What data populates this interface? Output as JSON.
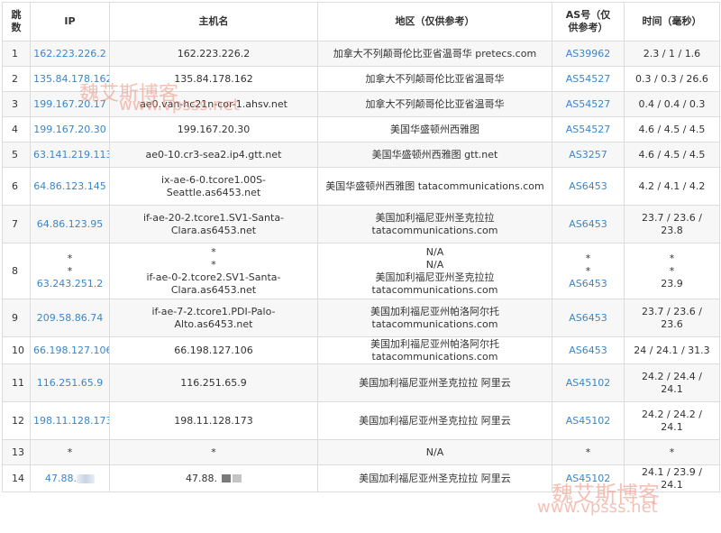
{
  "headers": {
    "hop": "跳数",
    "ip": "IP",
    "host": "主机名",
    "region": "地区（仅供参考）",
    "as": "AS号（仅供参考）",
    "time": "时间（毫秒）"
  },
  "rows": [
    {
      "hop": "1",
      "ip": [
        "162.223.226.2"
      ],
      "host": [
        "162.223.226.2"
      ],
      "region": [
        "加拿大不列颠哥伦比亚省温哥华 pretecs.com"
      ],
      "as": [
        "AS39962"
      ],
      "time": [
        "2.3 / 1 / 1.6"
      ]
    },
    {
      "hop": "2",
      "ip": [
        "135.84.178.162"
      ],
      "host": [
        "135.84.178.162"
      ],
      "region": [
        "加拿大不列颠哥伦比亚省温哥华"
      ],
      "as": [
        "AS54527"
      ],
      "time": [
        "0.3 / 0.3 / 26.6"
      ]
    },
    {
      "hop": "3",
      "ip": [
        "199.167.20.17"
      ],
      "host": [
        "ae0.van-hc21n-cor-1.ahsv.net"
      ],
      "region": [
        "加拿大不列颠哥伦比亚省温哥华"
      ],
      "as": [
        "AS54527"
      ],
      "time": [
        "0.4 / 0.4 / 0.3"
      ]
    },
    {
      "hop": "4",
      "ip": [
        "199.167.20.30"
      ],
      "host": [
        "199.167.20.30"
      ],
      "region": [
        "美国华盛顿州西雅图"
      ],
      "as": [
        "AS54527"
      ],
      "time": [
        "4.6 / 4.5 / 4.5"
      ]
    },
    {
      "hop": "5",
      "ip": [
        "63.141.219.113"
      ],
      "host": [
        "ae0-10.cr3-sea2.ip4.gtt.net"
      ],
      "region": [
        "美国华盛顿州西雅图 gtt.net"
      ],
      "as": [
        "AS3257"
      ],
      "time": [
        "4.6 / 4.5 / 4.5"
      ]
    },
    {
      "hop": "6",
      "ip": [
        "64.86.123.145"
      ],
      "host": [
        "ix-ae-6-0.tcore1.00S-",
        "Seattle.as6453.net"
      ],
      "region": [
        "美国华盛顿州西雅图 tatacommunications.com"
      ],
      "as": [
        "AS6453"
      ],
      "time": [
        "4.2 / 4.1 / 4.2"
      ]
    },
    {
      "hop": "7",
      "ip": [
        "64.86.123.95"
      ],
      "host": [
        "if-ae-20-2.tcore1.SV1-Santa-",
        "Clara.as6453.net"
      ],
      "region": [
        "美国加利福尼亚州圣克拉拉",
        "tatacommunications.com"
      ],
      "as": [
        "AS6453"
      ],
      "time": [
        "23.7 / 23.6 /",
        "23.8"
      ]
    },
    {
      "hop": "8",
      "ip": [
        "*",
        "*",
        "63.243.251.2"
      ],
      "host": [
        "*",
        "*",
        "if-ae-0-2.tcore2.SV1-Santa-",
        "Clara.as6453.net"
      ],
      "region": [
        "N/A",
        "N/A",
        "美国加利福尼亚州圣克拉拉",
        "tatacommunications.com"
      ],
      "as": [
        "*",
        "*",
        "AS6453"
      ],
      "time": [
        "*",
        "*",
        "23.9"
      ]
    },
    {
      "hop": "9",
      "ip": [
        "209.58.86.74"
      ],
      "host": [
        "if-ae-7-2.tcore1.PDI-Palo-",
        "Alto.as6453.net"
      ],
      "region": [
        "美国加利福尼亚州帕洛阿尔托",
        "tatacommunications.com"
      ],
      "as": [
        "AS6453"
      ],
      "time": [
        "23.7 / 23.6 /",
        "23.6"
      ]
    },
    {
      "hop": "10",
      "ip": [
        "66.198.127.106"
      ],
      "host": [
        "66.198.127.106"
      ],
      "region": [
        "美国加利福尼亚州帕洛阿尔托",
        "tatacommunications.com"
      ],
      "as": [
        "AS6453"
      ],
      "time": [
        "24 / 24.1 / 31.3"
      ]
    },
    {
      "hop": "11",
      "ip": [
        "116.251.65.9"
      ],
      "host": [
        "116.251.65.9"
      ],
      "region": [
        "美国加利福尼亚州圣克拉拉 阿里云"
      ],
      "as": [
        "AS45102"
      ],
      "time": [
        "24.2 / 24.4 /",
        "24.1"
      ]
    },
    {
      "hop": "12",
      "ip": [
        "198.11.128.173"
      ],
      "host": [
        "198.11.128.173"
      ],
      "region": [
        "美国加利福尼亚州圣克拉拉 阿里云"
      ],
      "as": [
        "AS45102"
      ],
      "time": [
        "24.2 / 24.2 /",
        "24.1"
      ]
    },
    {
      "hop": "13",
      "ip": [
        "*"
      ],
      "host": [
        "*"
      ],
      "region": [
        "N/A"
      ],
      "as": [
        "*"
      ],
      "time": [
        "*"
      ]
    },
    {
      "hop": "14",
      "ip": [
        "47.88."
      ],
      "host": [
        "47.88."
      ],
      "region": [
        "美国加利福尼亚州圣克拉拉 阿里云"
      ],
      "as": [
        "AS45102"
      ],
      "time": [
        "24.1 / 23.9 /",
        "24.1"
      ]
    }
  ],
  "watermarks": {
    "top_cn": "魏艾斯博客",
    "top_url": "www.vpsss.net",
    "bottom_cn": "魏艾斯博客",
    "bottom_url": "www.vpsss.net"
  },
  "colors": {
    "link": "#3b86c8",
    "border": "#dcdcdc",
    "stripe": "#f7f7f7",
    "watermark": "#ee8c78"
  }
}
